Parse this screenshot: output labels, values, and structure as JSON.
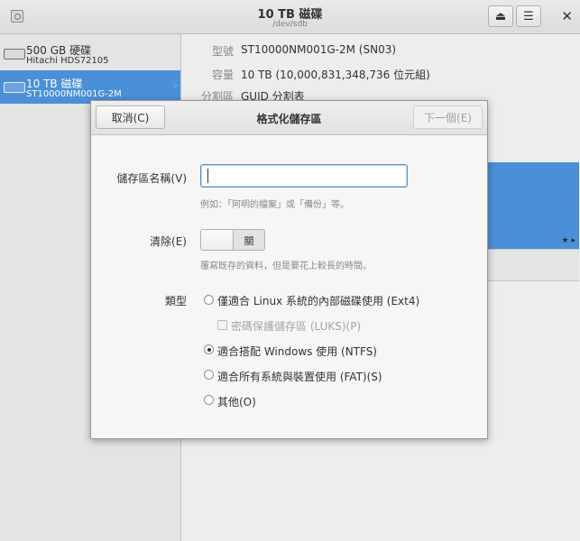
{
  "header": {
    "title": "10 TB 磁碟",
    "subtitle": "/dev/sdb",
    "eject_icon": "⏏",
    "menu_icon": "☰",
    "close_icon": "✕"
  },
  "sidebar": {
    "disks": [
      {
        "name": "500 GB 硬碟",
        "model": "Hitachi HDS72105"
      },
      {
        "name": "10 TB 磁碟",
        "model": "ST10000NM001G-2M"
      }
    ]
  },
  "details": {
    "model_label": "型號",
    "model_value": "ST10000NM001G-2M (SN03)",
    "size_label": "容量",
    "size_value": "10 TB (10,000,831,348,736 位元組)",
    "partition_label": "分割區",
    "partition_value": "GUID 分割表"
  },
  "dialog": {
    "cancel_label": "取消(C)",
    "title": "格式化儲存區",
    "next_label": "下一個(E)",
    "volume_name_label": "儲存區名稱(V)",
    "volume_name_value": "",
    "volume_name_hint": "例如：「阿明的檔案」或「備份」等。",
    "erase_label": "清除(E)",
    "erase_state": "關",
    "erase_hint": "覆寫既存的資料，但是要花上較長的時間。",
    "type_label": "類型",
    "types": [
      {
        "label": "僅適合 Linux 系統的內部磁碟使用 (Ext4)",
        "selected": false
      },
      {
        "label": "密碼保護儲存區 (LUKS)(P)",
        "selected": false
      },
      {
        "label": "適合搭配 Windows 使用 (NTFS)",
        "selected": true
      },
      {
        "label": "適合所有系統與裝置使用 (FAT)(S)",
        "selected": false
      },
      {
        "label": "其他(O)",
        "selected": false
      }
    ]
  }
}
